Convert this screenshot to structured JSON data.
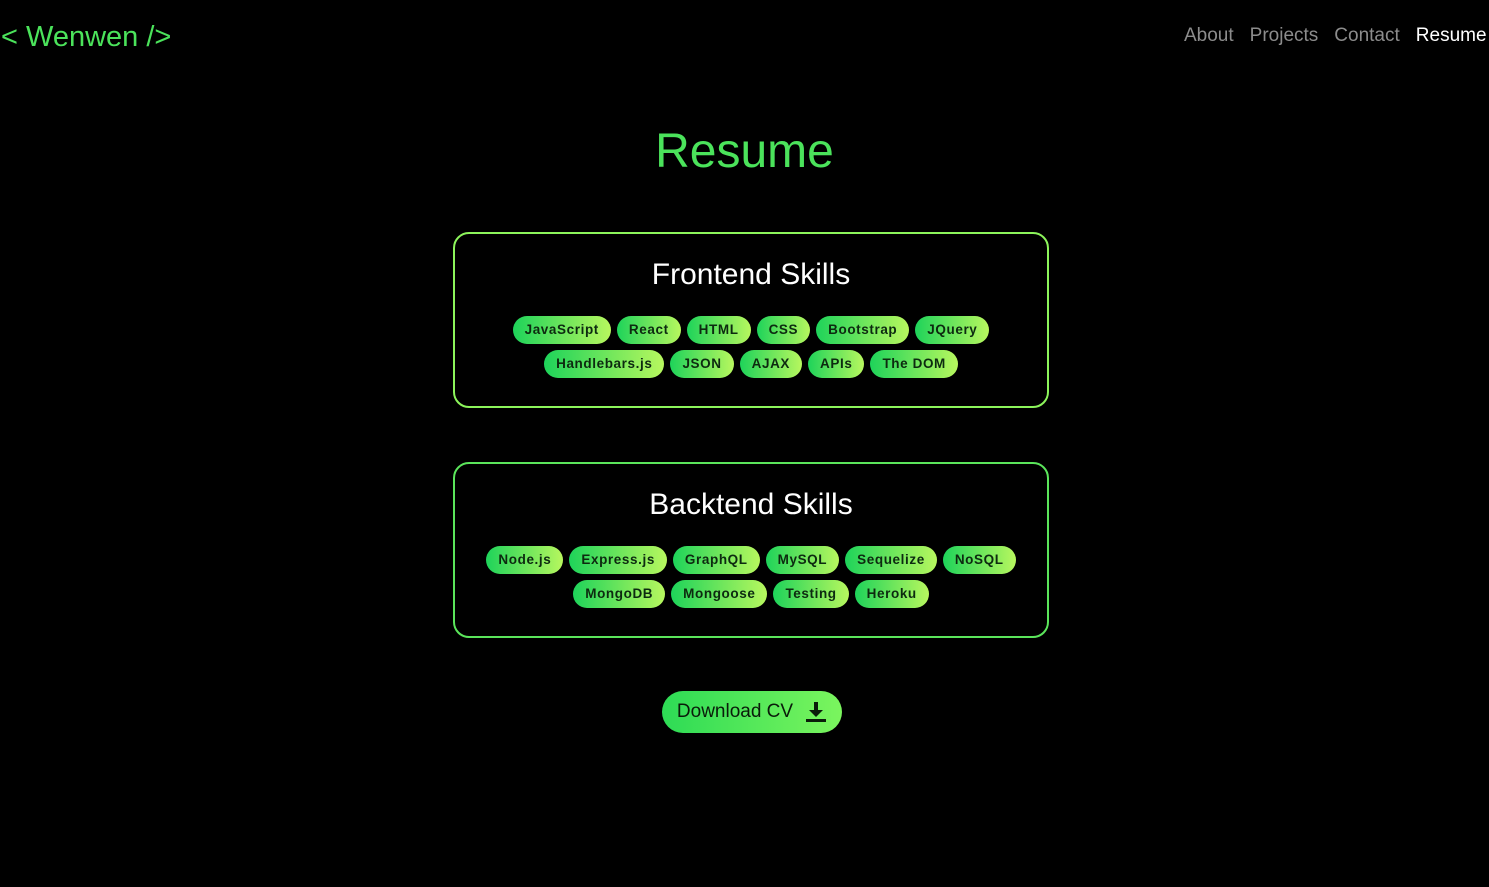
{
  "brand": {
    "label": "< Wenwen />",
    "color": "#4be35b"
  },
  "nav": {
    "items": [
      {
        "label": "About"
      },
      {
        "label": "Projects"
      },
      {
        "label": "Contact"
      },
      {
        "label": "Resume",
        "active": true
      }
    ]
  },
  "page": {
    "title": "Resume"
  },
  "frontend": {
    "title": "Frontend Skills",
    "skills": [
      "JavaScript",
      "React",
      "HTML",
      "CSS",
      "Bootstrap",
      "JQuery",
      "Handlebars.js",
      "JSON",
      "AJAX",
      "APIs",
      "The DOM"
    ]
  },
  "backend": {
    "title": "Backtend Skills",
    "skills": [
      "Node.js",
      "Express.js",
      "GraphQL",
      "MySQL",
      "Sequelize",
      "NoSQL",
      "MongoDB",
      "Mongoose",
      "Testing",
      "Heroku"
    ]
  },
  "download": {
    "label": "Download CV",
    "icon": "download-icon"
  },
  "colors": {
    "accent": "#4be35b",
    "background": "#000000",
    "badge_start": "#1ed35a",
    "badge_end": "#b7f75e"
  }
}
